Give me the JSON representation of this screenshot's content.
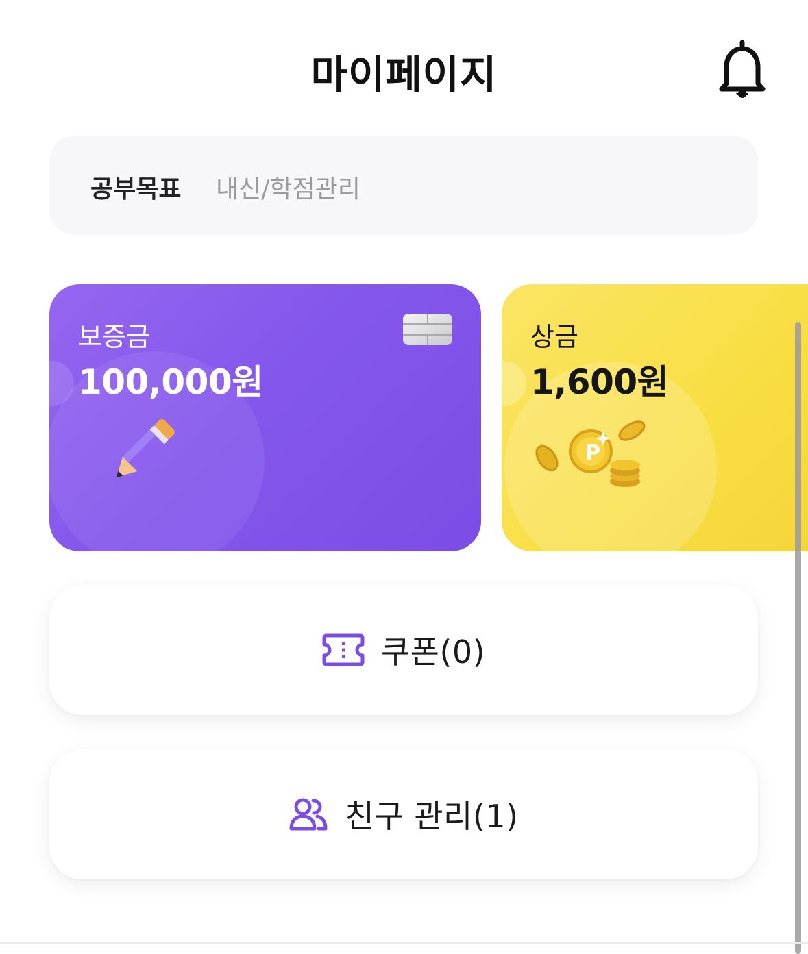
{
  "header": {
    "title": "마이페이지",
    "bell_icon": "bell-icon"
  },
  "goal": {
    "label": "공부목표",
    "value": "내신/학점관리"
  },
  "cards": {
    "deposit": {
      "label": "보증금",
      "amount": "100,000원",
      "icons": [
        "card-chip-icon",
        "pencil-icon"
      ],
      "color": "#8457ec"
    },
    "prize": {
      "label": "상금",
      "amount": "1,600원",
      "icons": [
        "coins-icon"
      ],
      "color": "#f9de42"
    }
  },
  "actions": {
    "coupon": {
      "label": "쿠폰(0)",
      "icon": "ticket-icon"
    },
    "friends": {
      "label": "친구 관리(1)",
      "icon": "friends-icon"
    }
  },
  "theme": {
    "accent": "#7b4de6",
    "goal_background": "#f7f7f9"
  }
}
